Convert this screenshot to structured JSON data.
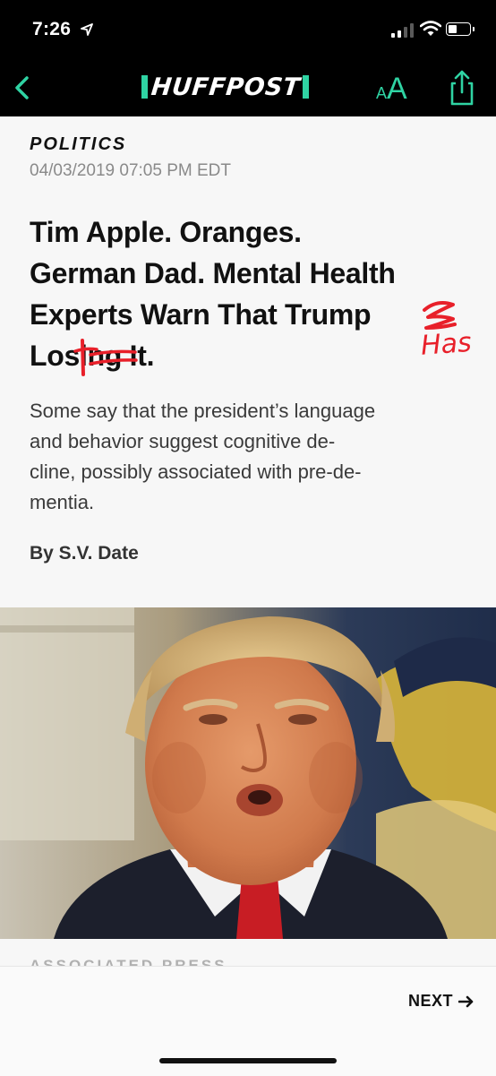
{
  "status_bar": {
    "time": "7:26"
  },
  "nav": {
    "brand": "HUFFPOST",
    "font_size_small": "A",
    "font_size_large": "A",
    "accent_color": "#2fd3a3"
  },
  "article": {
    "section": "POLITICS",
    "date": "04/03/2019 07:05 PM EDT",
    "headline_lines": [
      "Tim Apple. Oranges.",
      "German Dad. Mental Health",
      "Experts Warn That Trump",
      "Losing It."
    ],
    "headline_line4_prefix": "Los",
    "headline_line4_struck": "ing",
    "headline_line4_suffix": " It.",
    "handwritten_annotations": [
      "t",
      "Has"
    ],
    "dek_lines": [
      "Some say that the president’s language",
      "and behavior suggest cognitive de-",
      "cline, possibly associated with pre-de-",
      "mentia."
    ],
    "byline": "By S.V. Date",
    "photo_credit": "ASSOCIATED PRESS"
  },
  "footer": {
    "next_label": "NEXT"
  }
}
